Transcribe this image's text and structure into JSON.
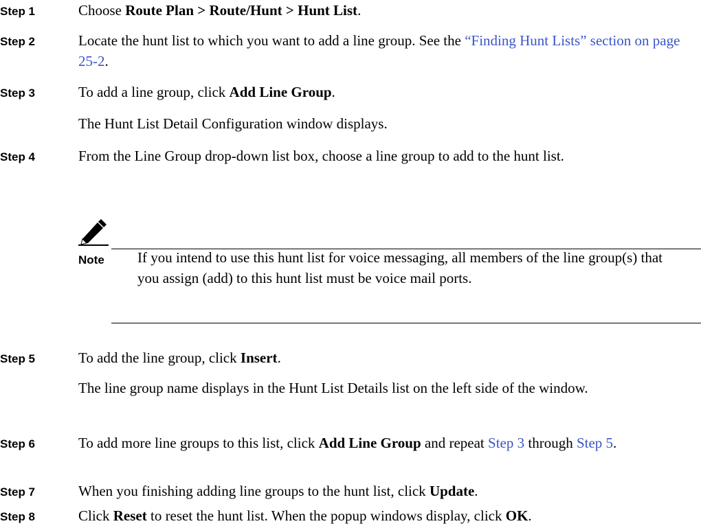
{
  "steps": [
    {
      "label": "Step 1",
      "parts": [
        {
          "t": "Choose "
        },
        {
          "t": "Route Plan > Route/Hunt > Hunt List",
          "b": true
        },
        {
          "t": "."
        }
      ]
    },
    {
      "label": "Step 2",
      "parts": [
        {
          "t": "Locate the hunt list to which you want to add a line group. See the "
        },
        {
          "t": "“Finding Hunt Lists” section on page 25-2",
          "link": true
        },
        {
          "t": "."
        }
      ]
    },
    {
      "label": "Step 3",
      "parts": [
        {
          "t": "To add a line group, click "
        },
        {
          "t": "Add Line Group",
          "b": true
        },
        {
          "t": "."
        }
      ],
      "followup": "The Hunt List Detail Configuration window displays."
    },
    {
      "label": "Step 4",
      "parts": [
        {
          "t": "From the Line Group drop-down list box, choose a line group to add to the hunt list."
        }
      ]
    },
    {
      "label": "Step 5",
      "parts": [
        {
          "t": "To add the line group, click "
        },
        {
          "t": "Insert",
          "b": true
        },
        {
          "t": "."
        }
      ],
      "followup": "The line group name displays in the Hunt List Details list on the left side of the window."
    },
    {
      "label": "Step 6",
      "parts": [
        {
          "t": "To add more line groups to this list, click "
        },
        {
          "t": "Add Line Group",
          "b": true
        },
        {
          "t": " and repeat "
        },
        {
          "t": "Step 3",
          "link": true
        },
        {
          "t": " through "
        },
        {
          "t": "Step 5",
          "link": true
        },
        {
          "t": "."
        }
      ]
    },
    {
      "label": "Step 7",
      "parts": [
        {
          "t": "When you finishing adding line groups to the hunt list, click "
        },
        {
          "t": "Update",
          "b": true
        },
        {
          "t": "."
        }
      ]
    },
    {
      "label": "Step 8",
      "parts": [
        {
          "t": "Click "
        },
        {
          "t": "Reset",
          "b": true
        },
        {
          "t": " to reset the hunt list. When the popup windows display, click "
        },
        {
          "t": "OK",
          "b": true
        },
        {
          "t": "."
        }
      ]
    }
  ],
  "note": {
    "label": "Note",
    "text": "If you intend to use this hunt list for voice messaging, all members of the line group(s) that you assign (add) to this hunt list must be voice mail ports.",
    "icon": "pencil-note-icon"
  },
  "colors": {
    "link": "#3a55c8",
    "text": "#000000"
  }
}
